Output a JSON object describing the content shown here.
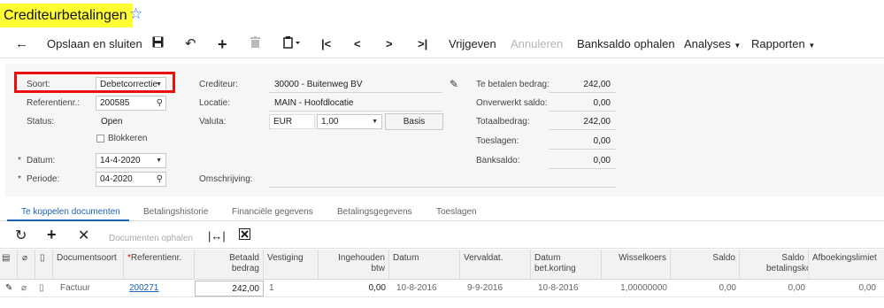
{
  "header": {
    "title": "Crediteurbetalingen"
  },
  "toolbar": {
    "save_close": "Opslaan en sluiten",
    "release": "Vrijgeven",
    "cancel": "Annuleren",
    "fetch_balance": "Banksaldo ophalen",
    "analyses": "Analyses",
    "reports": "Rapporten"
  },
  "form": {
    "type_label": "Soort:",
    "type_value": "Debetcorrectie",
    "ref_label": "Referentienr.:",
    "ref_value": "200585",
    "status_label": "Status:",
    "status_value": "Open",
    "block_label": "Blokkeren",
    "date_label": "Datum:",
    "date_value": "14-4-2020",
    "period_label": "Periode:",
    "period_value": "04-2020",
    "vendor_label": "Crediteur:",
    "vendor_value": "30000 - Buitenweg BV",
    "location_label": "Locatie:",
    "location_value": "MAIN - Hoofdlocatie",
    "currency_label": "Valuta:",
    "currency_value": "EUR",
    "rate_value": "1,00",
    "basis_label": "Basis",
    "description_label": "Omschrijving:",
    "description_value": "",
    "to_pay_label": "Te betalen bedrag:",
    "to_pay_value": "242,00",
    "unprocessed_label": "Onverwerkt saldo:",
    "unprocessed_value": "0,00",
    "total_label": "Totaalbedrag:",
    "total_value": "242,00",
    "charges_label": "Toeslagen:",
    "charges_value": "0,00",
    "bank_label": "Banksaldo:",
    "bank_value": "0,00",
    "required_mark": "*"
  },
  "tabs": [
    "Te koppelen documenten",
    "Betalingshistorie",
    "Financiële gegevens",
    "Betalingsgegevens",
    "Toeslagen"
  ],
  "grid_toolbar": {
    "load_docs": "Documenten ophalen"
  },
  "grid": {
    "columns": [
      "Documentsoort",
      "Referentienr.",
      "Betaald bedrag",
      "Vestiging",
      "Ingehouden btw",
      "Datum",
      "Vervaldat.",
      "Datum bet.korting",
      "Wisselkoers",
      "Saldo",
      "Saldo betalingskort",
      "Afboekingslimiet"
    ],
    "rows": [
      {
        "doc_type": "Factuur",
        "ref": "200271",
        "paid": "242,00",
        "branch": "1",
        "vat": "0,00",
        "date": "10-8-2016",
        "due": "9-9-2016",
        "disc_date": "10-8-2016",
        "rate": "1,00000000",
        "balance": "0,00",
        "disc_balance": "0,00",
        "writeoff": "0,00"
      }
    ]
  },
  "colors": {
    "title_highlight": "#ffff33",
    "accent": "#1b63b5",
    "highlight_box": "#e81010"
  }
}
